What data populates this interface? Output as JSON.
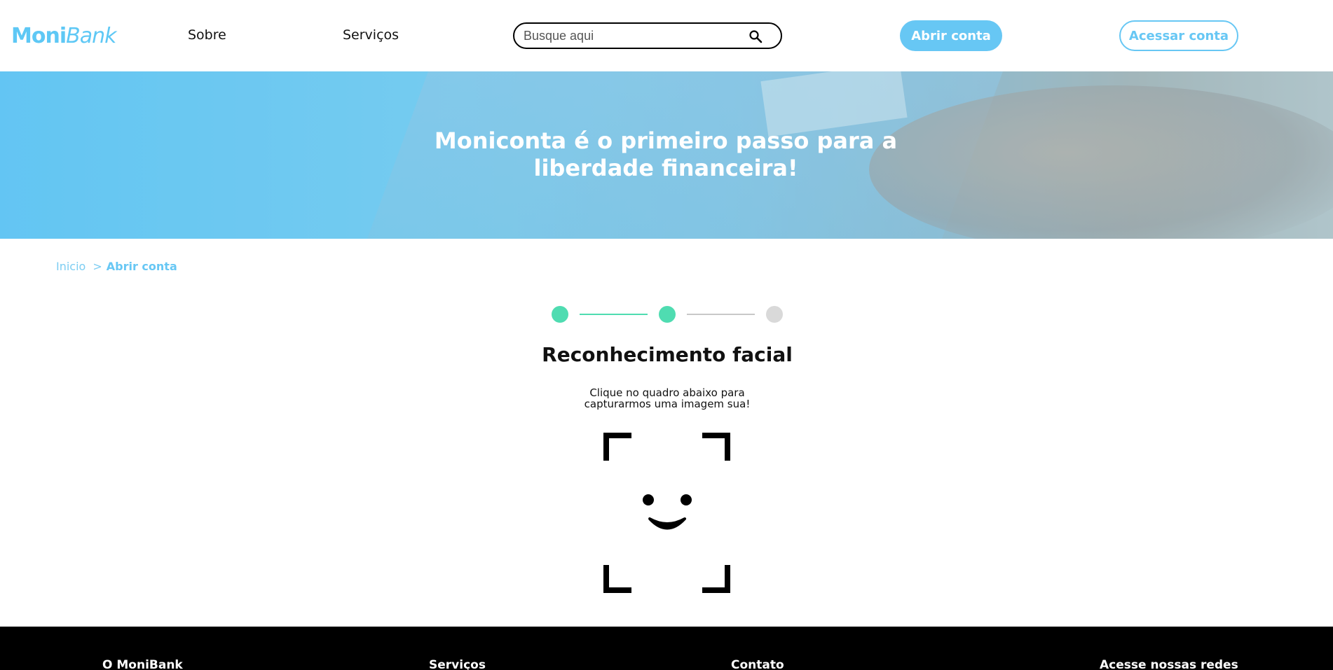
{
  "header": {
    "logo_bold": "Moni",
    "logo_italic": "Bank",
    "nav": {
      "sobre": "Sobre",
      "servicos": "Serviços"
    },
    "search": {
      "placeholder": "Busque aqui",
      "value": ""
    },
    "abrir_conta": "Abrir conta",
    "acessar_conta": "Acessar conta"
  },
  "banner": {
    "title": "Moniconta é o primeiro passo para a liberdade financeira!"
  },
  "breadcrumb": {
    "home": "Inicio",
    "separator": ">",
    "current": "Abrir conta"
  },
  "stepper": {
    "completed_steps": 2,
    "total_steps": 3,
    "title": "Reconhecimento facial",
    "description": "Clique no quadro abaixo para capturarmos uma imagem sua!"
  },
  "footer": {
    "columns": [
      "O MoniBank",
      "Serviços",
      "Contato",
      "Acesse nossas redes"
    ]
  },
  "colors": {
    "brand": "#67c7f4",
    "step_active": "#4fdcb1",
    "step_inactive": "#d9d9d9",
    "footer_bg": "#000000"
  },
  "icons": {
    "search": "search-icon",
    "face": "face-scan-icon"
  }
}
